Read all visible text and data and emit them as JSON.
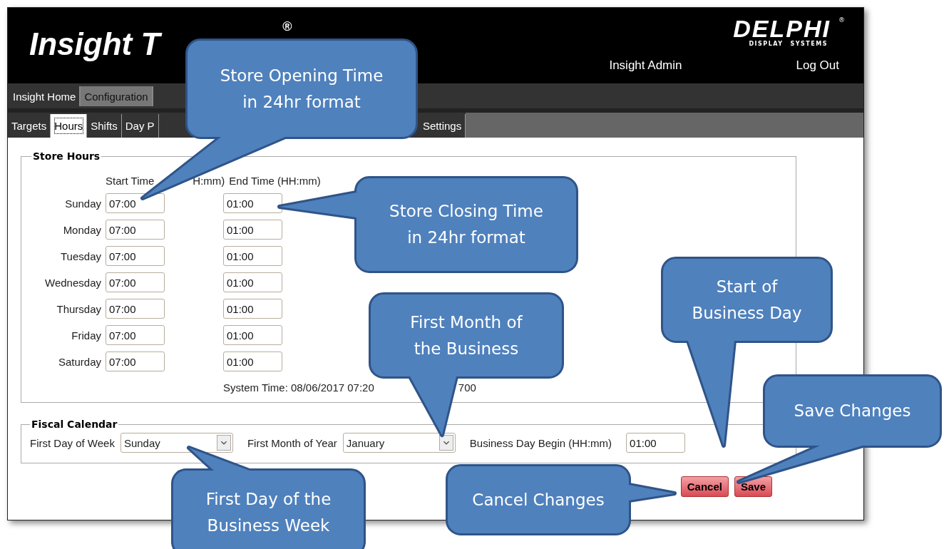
{
  "header": {
    "logo_text": "Insight T",
    "logo_mark": "®",
    "brand": "DELPHI",
    "brand_sub_left": "DISPLAY",
    "brand_sub_right": "SYSTEMS",
    "brand_mark": "®",
    "user": "Insight Admin",
    "logout": "Log Out"
  },
  "nav": [
    {
      "label": "Insight Home",
      "selected": false
    },
    {
      "label": "Configuration",
      "selected": true
    }
  ],
  "tabs": [
    {
      "label": "Targets",
      "selected": false
    },
    {
      "label": "Hours",
      "selected": true
    },
    {
      "label": "Shifts",
      "selected": false
    },
    {
      "label": "Day P",
      "selected": false
    }
  ],
  "tabs_right": [
    {
      "label": "Settings",
      "selected": false
    }
  ],
  "store_hours": {
    "title": "Store Hours",
    "start_header": "Start Time",
    "start_header_tail": "H:mm)",
    "end_header": "End Time (HH:mm)",
    "days": [
      {
        "day": "Sunday",
        "start": "07:00",
        "end": "01:00"
      },
      {
        "day": "Monday",
        "start": "07:00",
        "end": "01:00"
      },
      {
        "day": "Tuesday",
        "start": "07:00",
        "end": "01:00"
      },
      {
        "day": "Wednesday",
        "start": "07:00",
        "end": "01:00"
      },
      {
        "day": "Thursday",
        "start": "07:00",
        "end": "01:00"
      },
      {
        "day": "Friday",
        "start": "07:00",
        "end": "01:00"
      },
      {
        "day": "Saturday",
        "start": "07:00",
        "end": "01:00"
      }
    ],
    "system_time": "System Time: 08/06/2017 07:20",
    "system_time_tail": "700"
  },
  "fiscal": {
    "title": "Fiscal Calendar",
    "first_day_label": "First Day of Week",
    "first_day_value": "Sunday",
    "first_month_label": "First Month of Year",
    "first_month_value": "January",
    "business_day_label": "Business Day Begin (HH:mm)",
    "business_day_value": "01:00"
  },
  "buttons": [
    {
      "label": "Cancel"
    },
    {
      "label": "Save"
    }
  ],
  "callouts": [
    {
      "text": "Store Opening Time\nin 24hr format"
    },
    {
      "text": "Store Closing Time\nin 24hr format"
    },
    {
      "text": "First Month of\nthe Business"
    },
    {
      "text": "Start of\nBusiness Day"
    },
    {
      "text": "Save Changes"
    },
    {
      "text": "First Day of the\nBusiness Week"
    },
    {
      "text": "Cancel Changes"
    }
  ]
}
